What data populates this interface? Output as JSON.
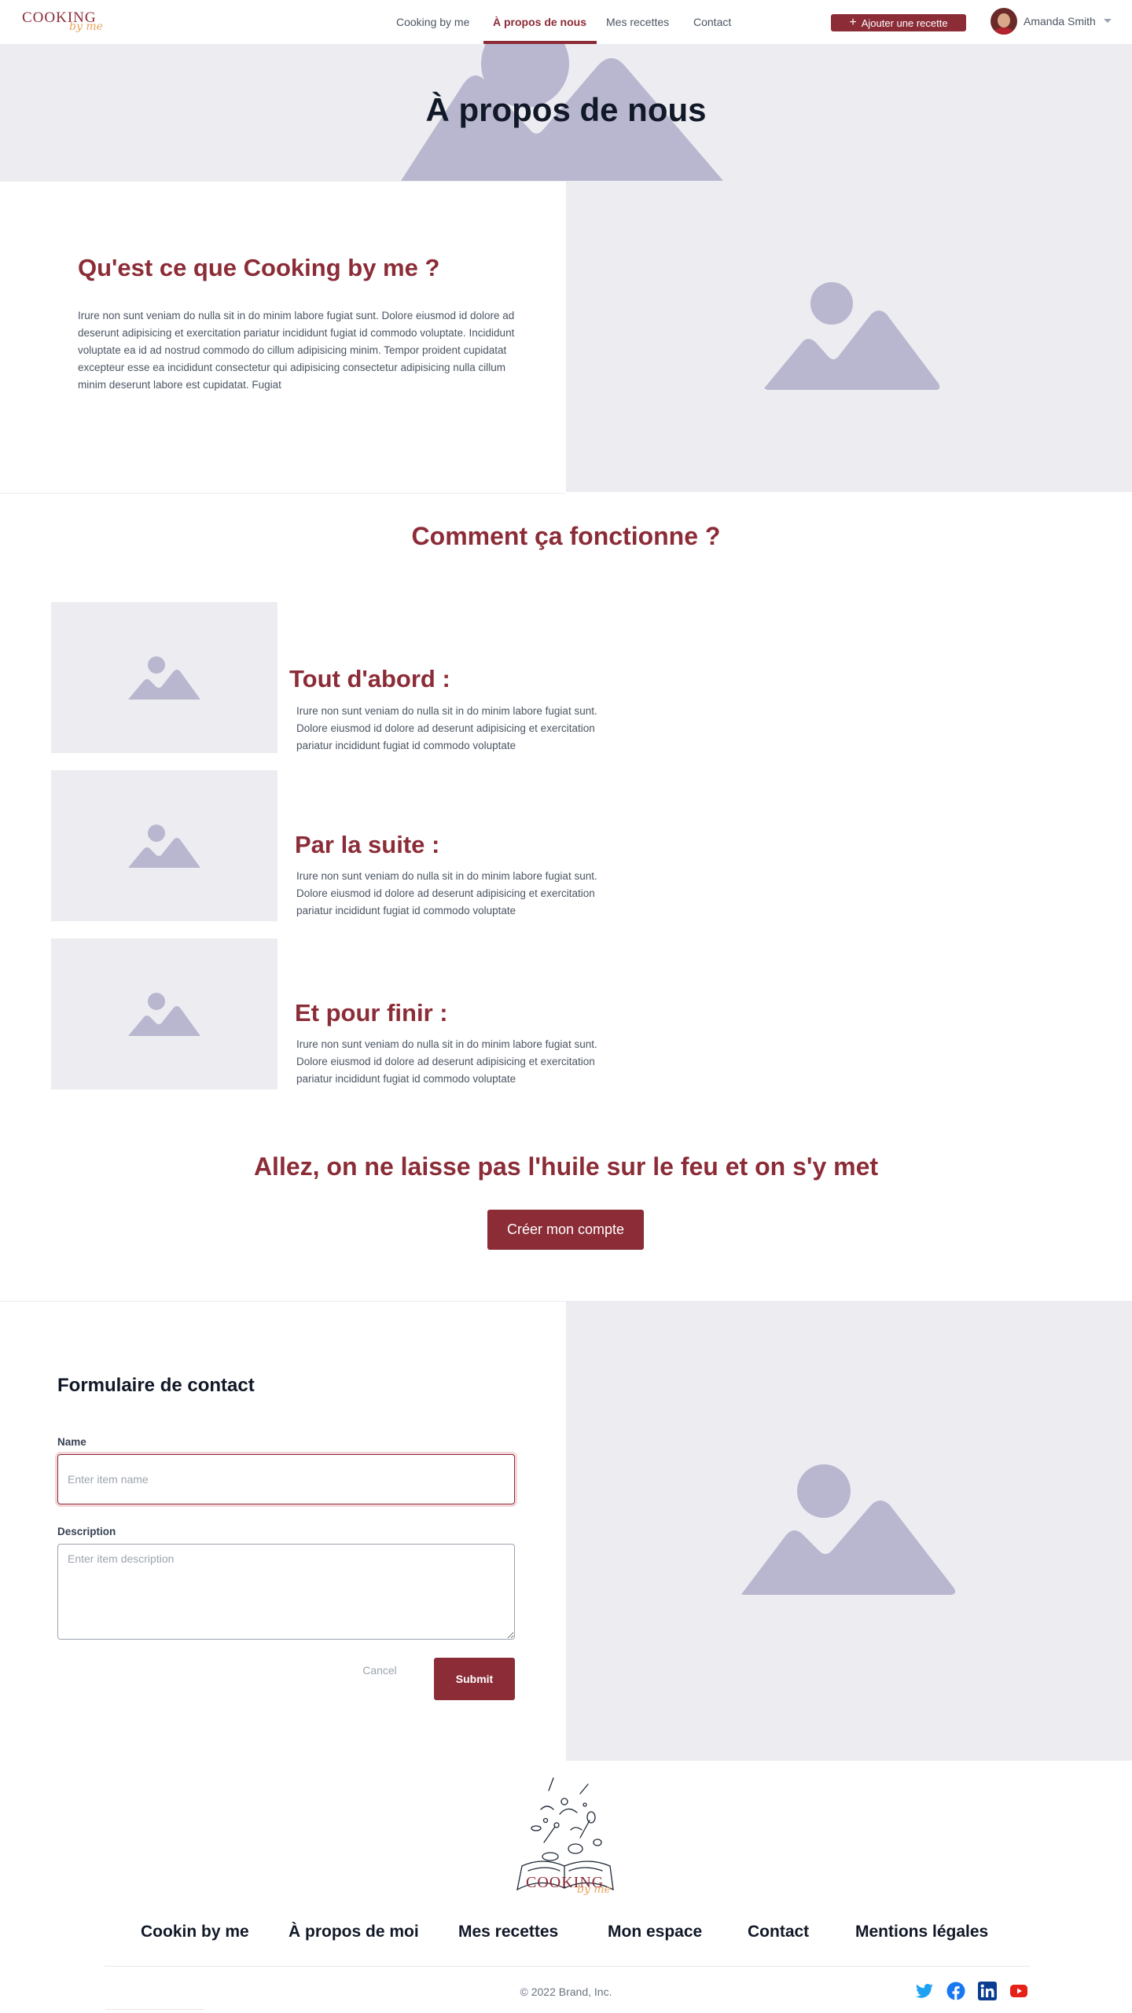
{
  "header": {
    "logo_text": "COOKING",
    "logo_script": "by me",
    "nav": [
      {
        "label": "Cooking by me"
      },
      {
        "label": "À propos de nous"
      },
      {
        "label": "Mes recettes"
      },
      {
        "label": "Contact"
      }
    ],
    "add_button_label": "Ajouter une recette",
    "user_name": "Amanda Smith"
  },
  "hero": {
    "title": "À propos de nous"
  },
  "about": {
    "title": "Qu'est ce que Cooking by me ?",
    "text": "Irure non sunt veniam do nulla sit in do minim labore fugiat sunt. Dolore eiusmod id dolore ad deserunt adipisicing et exercitation pariatur incididunt fugiat id commodo voluptate. Incididunt voluptate ea id ad nostrud commodo do cillum adipisicing minim. Tempor proident cupidatat excepteur esse ea incididunt consectetur qui adipisicing consectetur adipisicing nulla cillum minim deserunt labore est cupidatat. Fugiat"
  },
  "how": {
    "title": "Comment ça fonctionne ?",
    "steps": [
      {
        "title": "Tout d'abord :",
        "text": "Irure non sunt veniam do nulla sit in do minim labore fugiat sunt. Dolore eiusmod id dolore ad deserunt adipisicing et exercitation pariatur incididunt fugiat id commodo voluptate"
      },
      {
        "title": "Par la suite :",
        "text": "Irure non sunt veniam do nulla sit in do minim labore fugiat sunt. Dolore eiusmod id dolore ad deserunt adipisicing et exercitation pariatur incididunt fugiat id commodo voluptate"
      },
      {
        "title": "Et pour finir :",
        "text": "Irure non sunt veniam do nulla sit in do minim labore fugiat sunt. Dolore eiusmod id dolore ad deserunt adipisicing et exercitation pariatur incididunt fugiat id commodo voluptate"
      }
    ]
  },
  "cta": {
    "title": "Allez, on ne laisse pas l'huile sur le feu et on s'y met",
    "button_label": "Créer mon compte"
  },
  "contact": {
    "title": "Formulaire de contact",
    "name_label": "Name",
    "name_value": "",
    "name_placeholder": "Enter item name",
    "description_label": "Description",
    "description_value": "",
    "description_placeholder": "Enter item description",
    "cancel_label": "Cancel",
    "submit_label": "Submit"
  },
  "footer": {
    "logo_text": "COOKING",
    "logo_script": "by me",
    "links": [
      {
        "label": "Cookin by me"
      },
      {
        "label": "À propos de moi"
      },
      {
        "label": "Mes recettes"
      },
      {
        "label": "Mon espace"
      },
      {
        "label": "Contact"
      },
      {
        "label": "Mentions légales"
      }
    ],
    "copyright": "© 2022 Brand, Inc.",
    "social_icons": [
      "twitter-icon",
      "facebook-icon",
      "linkedin-icon",
      "youtube-icon"
    ]
  },
  "colors": {
    "brand": "#8b2c37",
    "placeholder_bg": "#ececf1",
    "placeholder_shape": "#b8b7cf",
    "twitter": "#1da1f2",
    "facebook": "#1877f2",
    "linkedin": "#0a66c2",
    "youtube": "#e62117"
  }
}
